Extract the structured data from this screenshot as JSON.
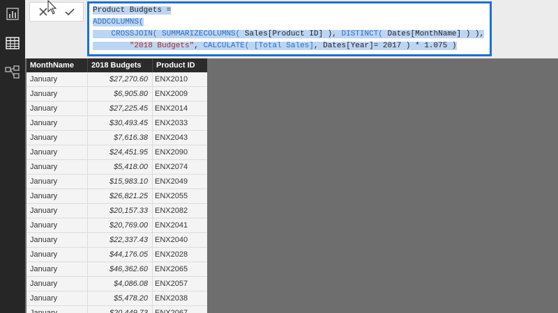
{
  "rail": {
    "icons": [
      "report-view-icon",
      "data-view-icon",
      "relationships-view-icon"
    ]
  },
  "formula_bar": {
    "cancel_icon": "close-icon",
    "commit_icon": "check-icon",
    "lines": [
      [
        {
          "t": "Product Budgets =",
          "c": "txt"
        }
      ],
      [
        {
          "t": "ADDCOLUMNS(",
          "c": "kw"
        }
      ],
      [
        {
          "t": "    ",
          "c": "txt"
        },
        {
          "t": "CROSSJOIN(",
          "c": "kw"
        },
        {
          "t": " ",
          "c": "txt"
        },
        {
          "t": "SUMMARIZECOLUMNS(",
          "c": "kw"
        },
        {
          "t": " Sales[Product ID] ), ",
          "c": "txt"
        },
        {
          "t": "DISTINCT(",
          "c": "kw"
        },
        {
          "t": " Dates[MonthName] ) ),",
          "c": "txt"
        }
      ],
      [
        {
          "t": "        ",
          "c": "txt"
        },
        {
          "t": "\"2018 Budgets\"",
          "c": "str"
        },
        {
          "t": ", ",
          "c": "txt"
        },
        {
          "t": "CALCULATE(",
          "c": "kw"
        },
        {
          "t": " ",
          "c": "txt"
        },
        {
          "t": "[Total Sales]",
          "c": "ref"
        },
        {
          "t": ", Dates[Year]= 2017 ) * 1.075 )",
          "c": "txt"
        }
      ]
    ]
  },
  "table": {
    "columns": [
      "MonthName",
      "2018 Budgets",
      "Product ID"
    ],
    "rows": [
      [
        "January",
        "$27,270.60",
        "ENX2010"
      ],
      [
        "January",
        "$6,905.80",
        "ENX2009"
      ],
      [
        "January",
        "$27,225.45",
        "ENX2014"
      ],
      [
        "January",
        "$30,493.45",
        "ENX2033"
      ],
      [
        "January",
        "$7,616.38",
        "ENX2043"
      ],
      [
        "January",
        "$24,451.95",
        "ENX2090"
      ],
      [
        "January",
        "$5,418.00",
        "ENX2074"
      ],
      [
        "January",
        "$15,983.10",
        "ENX2049"
      ],
      [
        "January",
        "$26,821.25",
        "ENX2055"
      ],
      [
        "January",
        "$20,157.33",
        "ENX2082"
      ],
      [
        "January",
        "$20,769.00",
        "ENX2041"
      ],
      [
        "January",
        "$22,337.43",
        "ENX2040"
      ],
      [
        "January",
        "$44,176.05",
        "ENX2028"
      ],
      [
        "January",
        "$46,362.60",
        "ENX2065"
      ],
      [
        "January",
        "$4,086.08",
        "ENX2057"
      ],
      [
        "January",
        "$5,478.20",
        "ENX2038"
      ],
      [
        "January",
        "$20,449.73",
        "ENX2067"
      ]
    ]
  },
  "colors": {
    "keyword": "#2f6fc2",
    "string": "#b3261e",
    "selection": "#bcd5f3",
    "editor_border": "#1e6fcf"
  }
}
